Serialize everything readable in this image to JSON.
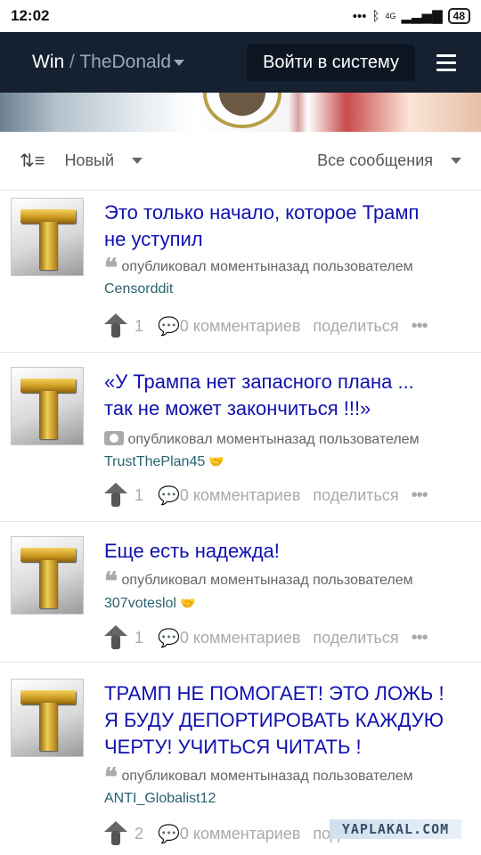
{
  "statusbar": {
    "time": "12:02",
    "signal": "4G",
    "battery": "48"
  },
  "header": {
    "brand": "Win",
    "separator": "/",
    "community": "TheDonald",
    "login_label": "Войти в систему"
  },
  "sortbar": {
    "sort_label": "Новый",
    "filter_label": "Все сообщения"
  },
  "posts": [
    {
      "title_line1": "Это только начало, которое Трамп",
      "title_line2": "не уступил",
      "meta": "опубликовал моментыназад пользователем",
      "author": "Censorddit",
      "votes": "1",
      "comments": "0 комментариев",
      "share": "поделиться"
    },
    {
      "title_line1": "«У Трампа нет запасного плана ...",
      "title_line2": "так не может закончиться !!!»",
      "meta": "опубликовал моментыназад пользователем",
      "author": "TrustThePlan45",
      "votes": "1",
      "comments": "0 комментариев",
      "share": "поделиться"
    },
    {
      "title_line1": "Еще есть надежда!",
      "meta": "опубликовал моментыназад пользователем",
      "author": "307voteslol",
      "votes": "1",
      "comments": "0 комментариев",
      "share": "поделиться"
    },
    {
      "title_line1": "ТРАМП НЕ ПОМОГАЕТ! ЭТО ЛОЖЬ !",
      "title_line2": "Я БУДУ ДЕПОРТИРОВАТЬ КАЖДУЮ",
      "title_line3": "ЧЕРТУ! УЧИТЬСЯ ЧИТАТЬ !",
      "meta": "опубликовал моментыназад пользователем",
      "author": "ANTI_Globalist12",
      "votes": "2",
      "comments": "0 комментариев",
      "share": "поделиться"
    }
  ],
  "watermark": "YAPLAKAL.COM",
  "colors": {
    "navbar": "#152030",
    "title_link": "#1010b0",
    "author_link": "#2a6070"
  }
}
